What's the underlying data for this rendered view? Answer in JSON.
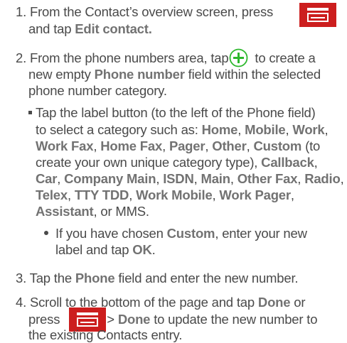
{
  "steps": [
    {
      "number": "1.",
      "line1": "From the Contact’s overview screen, press",
      "line2_prefix": "and tap ",
      "line2_bold": "Edit contact.",
      "icon": "menu-key-icon"
    },
    {
      "number": "2.",
      "line1_prefix": "From the phone numbers area, tap",
      "line1_suffix": "to create a",
      "line2_prefix": "new empty ",
      "line2_bold": "Phone number",
      "line2_suffix": " field within the selected",
      "line3": "phone number category.",
      "icon": "add-circle-icon"
    },
    {
      "number": "3.",
      "prefix": "Tap the ",
      "bold": "Phone",
      "suffix": " field and enter the new number."
    },
    {
      "number": "4.",
      "line1_prefix": "Scroll to the bottom of the page and tap ",
      "line1_bold": "Done",
      "line1_suffix": " or",
      "line2_prefix": "press",
      "line2_gt": ">",
      "line2_bold": "Done",
      "line2_suffix": " to update the new number to",
      "line3": "the existing Contacts entry.",
      "icon": "menu-key-icon"
    }
  ],
  "sub_bullet": {
    "l1": "Tap the label button (to the left of the Phone field)",
    "l2_prefix": "to select a category such as: ",
    "home": "Home",
    "c1": ", ",
    "mobile": "Mobile",
    "c2": ", ",
    "work": "Work",
    "c3": ",",
    "work_fax": "Work Fax",
    "c4": ", ",
    "home_fax": "Home Fax",
    "c5": ", ",
    "pager": "Pager",
    "c6": ", ",
    "other": "Other",
    "c7": ", ",
    "custom": "Custom",
    "l3_suffix": " (to",
    "l4_prefix": "create your own unique category type), ",
    "callback": "Callback",
    "c8": ",",
    "car": "Car",
    "c9": ", ",
    "company_main": "Company Main",
    "c10": ", ",
    "isdn": "ISDN",
    "c11": ", ",
    "main": "Main",
    "c12": ", ",
    "other_fax": "Other Fax",
    "c13": ", ",
    "radio": "Radio",
    "c14": ",",
    "telex": "Telex",
    "c15": ", ",
    "tty_tdd": "TTY TDD",
    "c16": ", ",
    "work_mobile": "Work Mobile",
    "c17": ", ",
    "work_pager": "Work Pager",
    "c18": ",",
    "assistant": "Assistant",
    "l8_suffix": ", or MMS."
  },
  "sub_sub_bullet": {
    "prefix": "If you have chosen ",
    "custom": "Custom",
    "suffix": ", enter your new",
    "l2_prefix": "label and tap ",
    "ok": "OK",
    "l2_suffix": "."
  },
  "colors": {
    "text": "#4a4a4a",
    "bold_text": "#727272",
    "menu_key": "#cc1e1e",
    "add_icon": "#2db82d"
  }
}
